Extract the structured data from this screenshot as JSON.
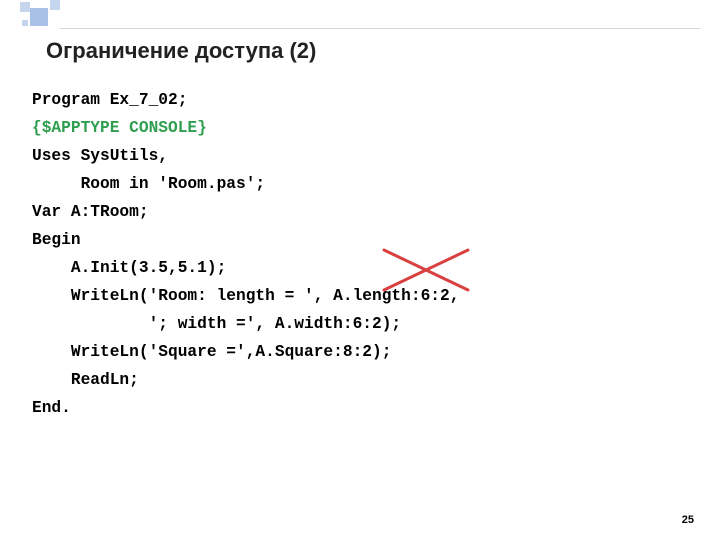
{
  "title": "Ограничение доступа (2)",
  "code": {
    "l1": "Program Ex_7_02;",
    "l2": "{$APPTYPE CONSOLE}",
    "l3": "Uses SysUtils,",
    "l4": "     Room in 'Room.pas';",
    "l5": "Var A:TRoom;",
    "l6": "Begin",
    "l7": "    A.Init(3.5,5.1);",
    "l8": "    WriteLn('Room: length = ', A.length:6:2,",
    "l9": "            '; width =', A.width:6:2);",
    "l10": "    WriteLn('Square =',A.Square:8:2);",
    "l11": "    ReadLn;",
    "l12": "End."
  },
  "pageNumber": "25",
  "crossColor": "#d94040"
}
